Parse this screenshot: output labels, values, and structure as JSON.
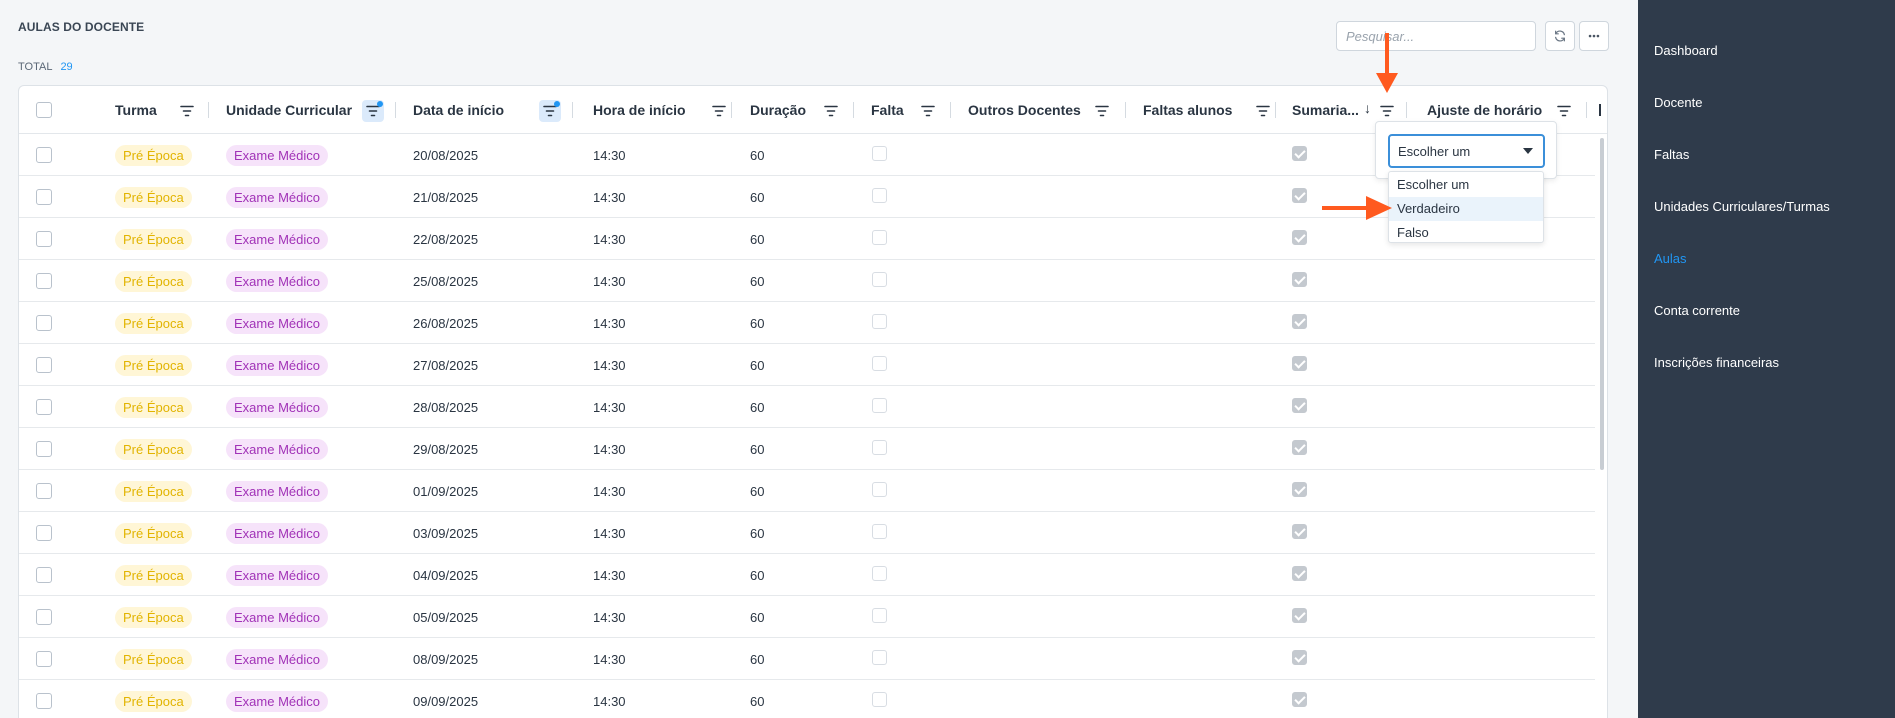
{
  "page": {
    "title": "AULAS DO DOCENTE",
    "total_label": "TOTAL",
    "total_count": "29",
    "search_placeholder": "Pesquisar..."
  },
  "toolbar": {
    "refresh_icon": "refresh-icon",
    "more_icon": "more-horizontal-icon"
  },
  "table": {
    "columns": [
      {
        "label": "Turma"
      },
      {
        "label": "Unidade Curricular"
      },
      {
        "label": "Data de início"
      },
      {
        "label": "Hora de início"
      },
      {
        "label": "Duração"
      },
      {
        "label": "Falta"
      },
      {
        "label": "Outros Docentes"
      },
      {
        "label": "Faltas alunos"
      },
      {
        "label": "Sumaria..."
      },
      {
        "label": "Ajuste de horário"
      }
    ],
    "active_filters": [
      "Unidade Curricular",
      "Data de início"
    ],
    "sorted_column": "Sumaria...",
    "sort_direction": "descending",
    "rows": [
      {
        "turma": "Pré Época",
        "uc": "Exame Médico",
        "data": "20/08/2025",
        "hora": "14:30",
        "duracao": "60",
        "falta": false,
        "sumariada": true
      },
      {
        "turma": "Pré Época",
        "uc": "Exame Médico",
        "data": "21/08/2025",
        "hora": "14:30",
        "duracao": "60",
        "falta": false,
        "sumariada": true
      },
      {
        "turma": "Pré Época",
        "uc": "Exame Médico",
        "data": "22/08/2025",
        "hora": "14:30",
        "duracao": "60",
        "falta": false,
        "sumariada": true
      },
      {
        "turma": "Pré Época",
        "uc": "Exame Médico",
        "data": "25/08/2025",
        "hora": "14:30",
        "duracao": "60",
        "falta": false,
        "sumariada": true
      },
      {
        "turma": "Pré Época",
        "uc": "Exame Médico",
        "data": "26/08/2025",
        "hora": "14:30",
        "duracao": "60",
        "falta": false,
        "sumariada": true
      },
      {
        "turma": "Pré Época",
        "uc": "Exame Médico",
        "data": "27/08/2025",
        "hora": "14:30",
        "duracao": "60",
        "falta": false,
        "sumariada": true
      },
      {
        "turma": "Pré Época",
        "uc": "Exame Médico",
        "data": "28/08/2025",
        "hora": "14:30",
        "duracao": "60",
        "falta": false,
        "sumariada": true
      },
      {
        "turma": "Pré Época",
        "uc": "Exame Médico",
        "data": "29/08/2025",
        "hora": "14:30",
        "duracao": "60",
        "falta": false,
        "sumariada": true
      },
      {
        "turma": "Pré Época",
        "uc": "Exame Médico",
        "data": "01/09/2025",
        "hora": "14:30",
        "duracao": "60",
        "falta": false,
        "sumariada": true
      },
      {
        "turma": "Pré Época",
        "uc": "Exame Médico",
        "data": "03/09/2025",
        "hora": "14:30",
        "duracao": "60",
        "falta": false,
        "sumariada": true
      },
      {
        "turma": "Pré Época",
        "uc": "Exame Médico",
        "data": "04/09/2025",
        "hora": "14:30",
        "duracao": "60",
        "falta": false,
        "sumariada": true
      },
      {
        "turma": "Pré Época",
        "uc": "Exame Médico",
        "data": "05/09/2025",
        "hora": "14:30",
        "duracao": "60",
        "falta": false,
        "sumariada": true
      },
      {
        "turma": "Pré Época",
        "uc": "Exame Médico",
        "data": "08/09/2025",
        "hora": "14:30",
        "duracao": "60",
        "falta": false,
        "sumariada": true
      },
      {
        "turma": "Pré Época",
        "uc": "Exame Médico",
        "data": "09/09/2025",
        "hora": "14:30",
        "duracao": "60",
        "falta": false,
        "sumariada": true
      }
    ]
  },
  "filter_dropdown": {
    "selected": "Escolher um",
    "options": [
      "Escolher um",
      "Verdadeiro",
      "Falso"
    ],
    "hovered_option": "Verdadeiro"
  },
  "sidebar": {
    "items": [
      {
        "label": "Dashboard",
        "active": false
      },
      {
        "label": "Docente",
        "active": false
      },
      {
        "label": "Faltas",
        "active": false
      },
      {
        "label": "Unidades Curriculares/Turmas",
        "active": false
      },
      {
        "label": "Aulas",
        "active": true
      },
      {
        "label": "Conta corrente",
        "active": false
      },
      {
        "label": "Inscrições financeiras",
        "active": false
      }
    ]
  },
  "colors": {
    "accent": "#2196f3",
    "sidebar_bg": "#2f3b4b",
    "annotation_arrow": "#ff5a1f",
    "pill_yellow_text": "#e2b400",
    "pill_purple_text": "#a132b7"
  }
}
